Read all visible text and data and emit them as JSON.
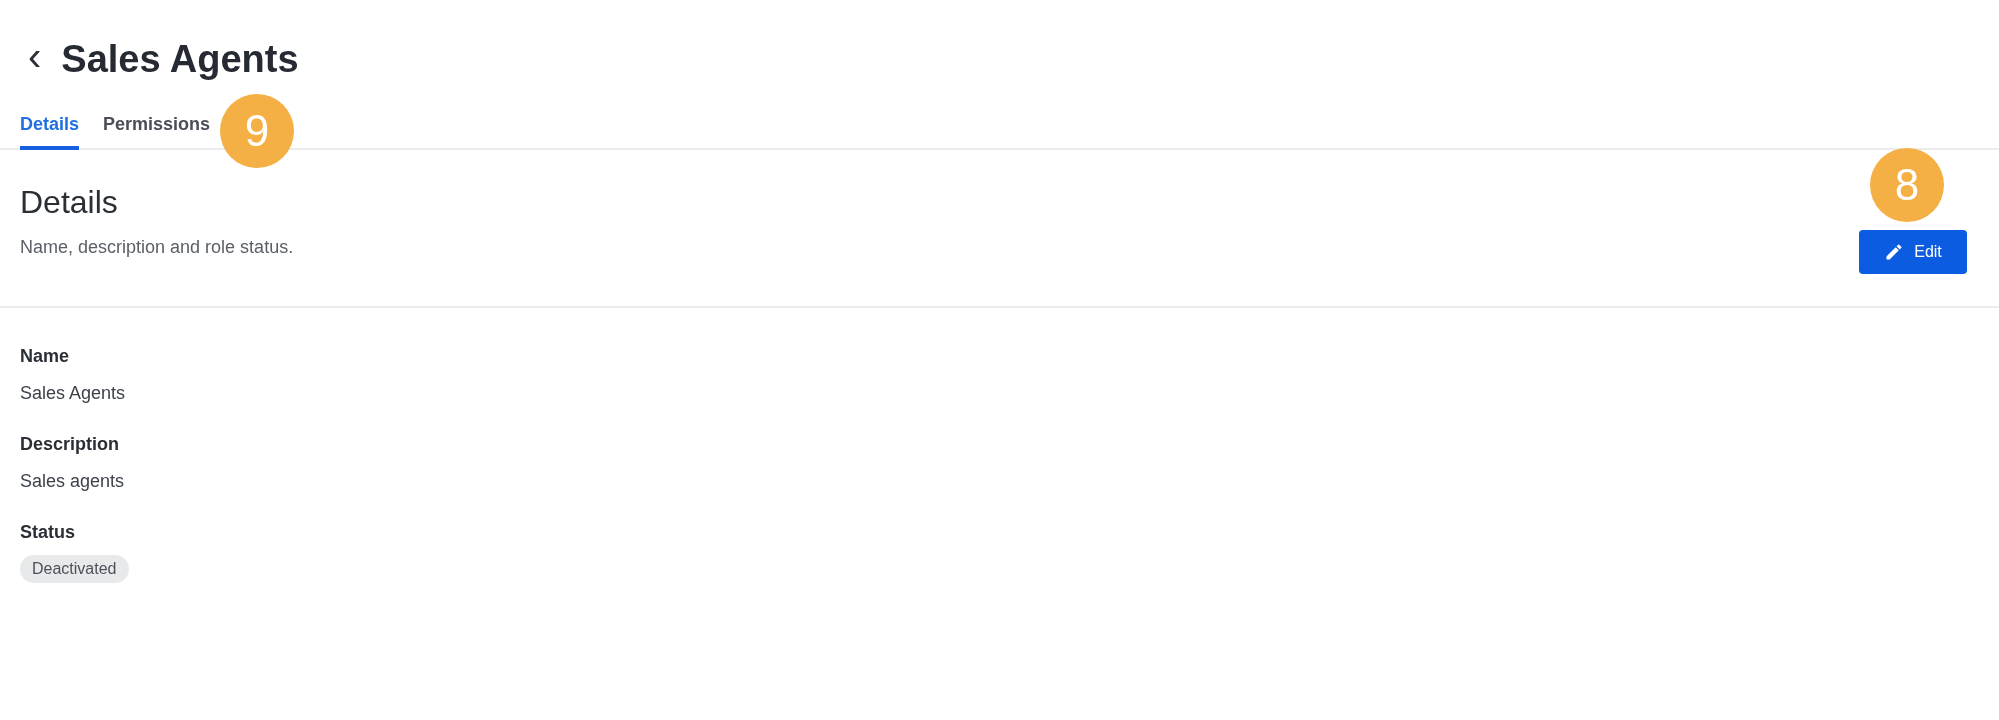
{
  "header": {
    "back": "‹",
    "title": "Sales Agents"
  },
  "tabs": [
    {
      "label": "Details",
      "selected": true
    },
    {
      "label": "Permissions",
      "selected": false
    }
  ],
  "tabs_callout": "9",
  "section": {
    "title": "Details",
    "subtitle": "Name, description and role status.",
    "button": "Edit",
    "callout": "8"
  },
  "fields": [
    {
      "kind": "text",
      "label": "Name",
      "value": "Sales Agents"
    },
    {
      "kind": "text",
      "label": "Description",
      "value": "Sales agents"
    },
    {
      "kind": "chip",
      "label": "Status",
      "value": "Deactivated"
    }
  ]
}
